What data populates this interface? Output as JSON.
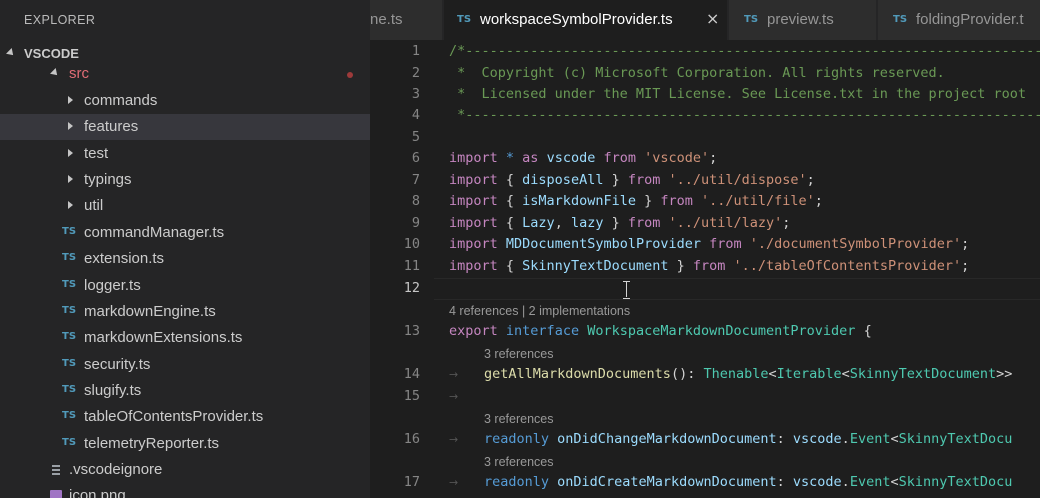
{
  "sidebar": {
    "title": "EXPLORER",
    "section": "VSCODE",
    "items": [
      {
        "label": "src",
        "kind": "folder-open",
        "color": "#e06c75",
        "modified": true
      },
      {
        "label": "commands",
        "kind": "folder"
      },
      {
        "label": "features",
        "kind": "folder",
        "selected": true
      },
      {
        "label": "test",
        "kind": "folder"
      },
      {
        "label": "typings",
        "kind": "folder"
      },
      {
        "label": "util",
        "kind": "folder"
      },
      {
        "label": "commandManager.ts",
        "kind": "ts"
      },
      {
        "label": "extension.ts",
        "kind": "ts"
      },
      {
        "label": "logger.ts",
        "kind": "ts"
      },
      {
        "label": "markdownEngine.ts",
        "kind": "ts"
      },
      {
        "label": "markdownExtensions.ts",
        "kind": "ts"
      },
      {
        "label": "security.ts",
        "kind": "ts"
      },
      {
        "label": "slugify.ts",
        "kind": "ts"
      },
      {
        "label": "tableOfContentsProvider.ts",
        "kind": "ts"
      },
      {
        "label": "telemetryReporter.ts",
        "kind": "ts"
      },
      {
        "label": ".vscodeignore",
        "kind": "text"
      },
      {
        "label": "icon.png",
        "kind": "image"
      }
    ],
    "ts_badge": "TS"
  },
  "tabs": [
    {
      "label": "ne.ts",
      "icon": "",
      "active": false
    },
    {
      "label": "workspaceSymbolProvider.ts",
      "icon": "TS",
      "active": true,
      "close": "×"
    },
    {
      "label": "preview.ts",
      "icon": "TS",
      "active": false
    },
    {
      "label": "foldingProvider.t",
      "icon": "TS",
      "active": false
    }
  ],
  "editor": {
    "line_numbers": [
      "1",
      "2",
      "3",
      "4",
      "5",
      "6",
      "7",
      "8",
      "9",
      "10",
      "11",
      "12",
      "13",
      "14",
      "15",
      "16",
      "17"
    ],
    "current_line": "12",
    "lines": {
      "l1": "/*---------------------------------------------------------------------------------------------",
      "l2": " *  Copyright (c) Microsoft Corporation. All rights reserved.",
      "l3": " *  Licensed under the MIT License. See License.txt in the project root",
      "l4": " *--------------------------------------------------------------------------------------------*/",
      "l6": [
        "import",
        " * ",
        "as",
        " vscode ",
        "from",
        " 'vscode'",
        ";"
      ],
      "l7": [
        "import",
        " { ",
        "disposeAll",
        " } ",
        "from",
        " '../util/dispose'",
        ";"
      ],
      "l8": [
        "import",
        " { ",
        "isMarkdownFile",
        " } ",
        "from",
        " '../util/file'",
        ";"
      ],
      "l9": [
        "import",
        " { ",
        "Lazy",
        ", ",
        "lazy",
        " } ",
        "from",
        " '../util/lazy'",
        ";"
      ],
      "l10": [
        "import",
        " ",
        "MDDocumentSymbolProvider",
        " ",
        "from",
        " './documentSymbolProvider'",
        ";"
      ],
      "l11": [
        "import",
        " { ",
        "SkinnyTextDocument",
        " } ",
        "from",
        " '../tableOfContentsProvider'",
        ";"
      ],
      "l13": [
        "export",
        " ",
        "interface",
        " ",
        "WorkspaceMarkdownDocumentProvider",
        " {"
      ],
      "l14": [
        "getAllMarkdownDocuments",
        "(): ",
        "Thenable",
        "<",
        "Iterable",
        "<",
        "SkinnyTextDocument",
        ">>"
      ],
      "l16": [
        "readonly",
        " ",
        "onDidChangeMarkdownDocument",
        ": ",
        "vscode",
        ".",
        "Event",
        "<",
        "SkinnyTextDocu"
      ],
      "l17": [
        "readonly",
        " ",
        "onDidCreateMarkdownDocument",
        ": ",
        "vscode",
        ".",
        "Event",
        "<",
        "SkinnyTextDocu"
      ]
    },
    "codelens": {
      "c13": "4 references | 2 implementations",
      "c14": "3 references",
      "c16": "3 references",
      "c17": "3 references"
    },
    "indent_marker": "→"
  },
  "colors": {
    "comment": "#6a9955",
    "keyword": "#c586c0",
    "storage": "#569cd6",
    "string": "#ce9178",
    "variable": "#9cdcfe",
    "type": "#4ec9b0",
    "function": "#dcdcaa"
  }
}
